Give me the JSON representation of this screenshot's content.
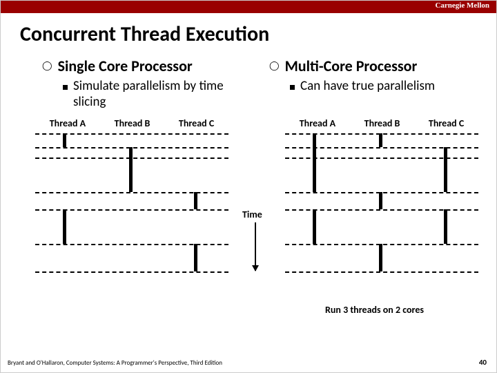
{
  "header": {
    "brand": "Carnegie Mellon"
  },
  "title": "Concurrent Thread Execution",
  "left": {
    "heading": "Single Core Processor",
    "sub": "Simulate parallelism by time slicing",
    "threads": {
      "a": "Thread A",
      "b": "Thread B",
      "c": "Thread C"
    }
  },
  "right": {
    "heading": "Multi-Core Processor",
    "sub": "Can have true parallelism",
    "threads": {
      "a": "Thread A",
      "b": "Thread B",
      "c": "Thread C"
    },
    "caption": "Run 3 threads on 2 cores"
  },
  "time_label": "Time",
  "footer": {
    "citation": "Bryant and O'Hallaron, Computer Systems: A Programmer's Perspective, Third Edition",
    "page": "40"
  },
  "chart_data": {
    "type": "timeline",
    "left_panel": {
      "description": "Single core time-sliced execution of 3 threads",
      "time_slices": [
        0,
        20,
        35,
        85,
        110,
        160,
        200
      ],
      "segments": [
        {
          "thread": "A",
          "start": 0,
          "end": 20
        },
        {
          "thread": "B",
          "start": 20,
          "end": 35
        },
        {
          "thread": "B",
          "start": 35,
          "end": 85
        },
        {
          "thread": "C",
          "start": 85,
          "end": 110
        },
        {
          "thread": "A",
          "start": 110,
          "end": 160
        },
        {
          "thread": "C",
          "start": 160,
          "end": 200
        }
      ]
    },
    "right_panel": {
      "description": "Multi-core (2 cores) parallel execution of 3 threads",
      "time_slices": [
        0,
        20,
        35,
        85,
        110,
        160,
        200
      ],
      "segments": [
        {
          "thread": "A",
          "start": 0,
          "end": 85
        },
        {
          "thread": "A",
          "start": 110,
          "end": 160
        },
        {
          "thread": "B",
          "start": 0,
          "end": 20
        },
        {
          "thread": "B",
          "start": 85,
          "end": 110
        },
        {
          "thread": "B",
          "start": 160,
          "end": 200
        },
        {
          "thread": "C",
          "start": 20,
          "end": 85
        },
        {
          "thread": "C",
          "start": 110,
          "end": 160
        }
      ]
    }
  }
}
